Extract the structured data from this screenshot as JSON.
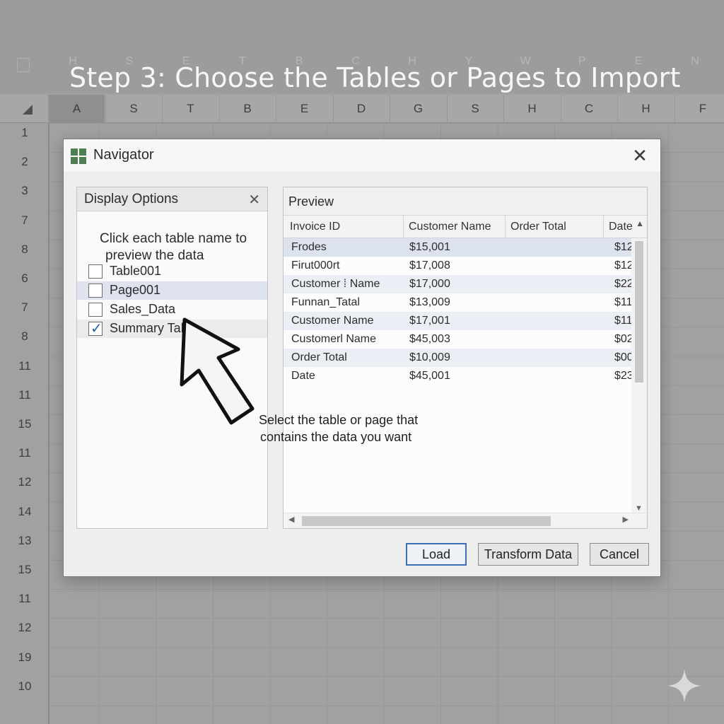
{
  "tutorial": {
    "step_title": "Step 3: Choose the Tables or Pages to Import",
    "callout_line1": "Select the table or page that",
    "callout_line2": "contains the data you want"
  },
  "spreadsheet": {
    "ghost_columns": [
      "H",
      "S",
      "E",
      "T",
      "B",
      "C",
      "H",
      "Y",
      "W",
      "P",
      "E",
      "N"
    ],
    "column_headers": [
      "A",
      "S",
      "T",
      "B",
      "E",
      "D",
      "G",
      "S",
      "H",
      "C",
      "H",
      "F"
    ],
    "selected_column": "A",
    "row_headers": [
      "1",
      "2",
      "3",
      "7",
      "8",
      "6",
      "7",
      "8",
      "11",
      "11",
      "15",
      "11",
      "12",
      "14",
      "13",
      "15",
      "11",
      "12",
      "19",
      "10"
    ]
  },
  "dialog": {
    "title": "Navigator",
    "close_glyph": "✕",
    "display_options": {
      "title": "Display Options",
      "close_glyph": "✕",
      "instruction_line1": "Click each table name to",
      "instruction_line2": "preview the data",
      "items": [
        {
          "label": "Table001",
          "checked": false
        },
        {
          "label": "Page001",
          "checked": false
        },
        {
          "label": "Sales_Data",
          "checked": false
        },
        {
          "label": "Summary Tab",
          "checked": true
        }
      ]
    },
    "preview": {
      "title": "Preview",
      "columns": [
        "Invoice ID",
        "Customer Name",
        "Order Total",
        "Date"
      ],
      "rows": [
        [
          "Frodes",
          "$15,001",
          "",
          "$12"
        ],
        [
          "Firut000rt",
          "$17,008",
          "",
          "$12"
        ],
        [
          "Customer ⁞ Name",
          "$17,000",
          "",
          "$22"
        ],
        [
          "Funnan_Tatal",
          "$13,009",
          "",
          "$11"
        ],
        [
          "Customer Name",
          "$17,001",
          "",
          "$11"
        ],
        [
          "Customerl Name",
          "$45,003",
          "",
          "$02"
        ],
        [
          "Order Total",
          "$10,009",
          "",
          "$00"
        ],
        [
          "Date",
          "$45,001",
          "",
          "$23"
        ]
      ]
    },
    "buttons": {
      "load": "Load",
      "transform": "Transform Data",
      "cancel": "Cancel"
    }
  },
  "colors": {
    "dialog_bg": "#eeeeef",
    "selection_blue": "#3d6fb6",
    "app_icon_green": "#4f7d54"
  }
}
